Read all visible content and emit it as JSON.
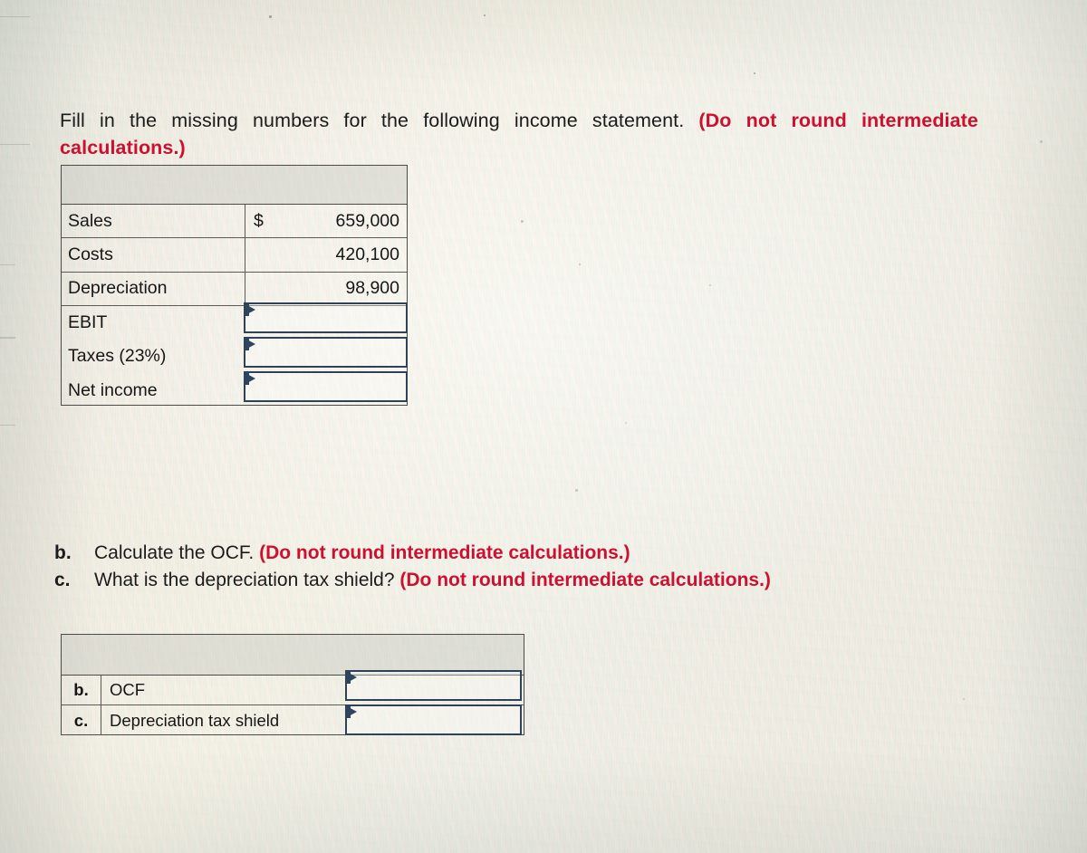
{
  "prompt": {
    "part_a_text": "Fill in the missing numbers for the following income statement.",
    "part_a_note": "(Do not round intermediate calculations.)"
  },
  "income_statement": {
    "header_blank": "",
    "rows": [
      {
        "label": "Sales",
        "currency": "$",
        "value": "659,000",
        "is_input": false
      },
      {
        "label": "Costs",
        "currency": "",
        "value": "420,100",
        "is_input": false
      },
      {
        "label": "Depreciation",
        "currency": "",
        "value": "98,900",
        "is_input": false
      },
      {
        "label": "EBIT",
        "currency": "",
        "value": "",
        "is_input": true
      },
      {
        "label": "Taxes (23%)",
        "currency": "",
        "value": "",
        "is_input": true
      },
      {
        "label": "Net income",
        "currency": "",
        "value": "",
        "is_input": true
      }
    ]
  },
  "questions": [
    {
      "marker": "b.",
      "text": "Calculate the OCF.",
      "note": "(Do not round intermediate calculations.)"
    },
    {
      "marker": "c.",
      "text": "What is the depreciation tax shield?",
      "note": "(Do not round intermediate calculations.)"
    }
  ],
  "answer_table": {
    "header_blank": "",
    "rows": [
      {
        "marker": "b.",
        "label": "OCF",
        "value": ""
      },
      {
        "marker": "c.",
        "label": "Depreciation tax shield",
        "value": ""
      }
    ]
  },
  "colors": {
    "note_red": "#cd1030",
    "text_black": "#161616",
    "input_border_navy": "#2f4258",
    "table_border_gray": "#4b4b48",
    "page_background": "#eceade"
  }
}
